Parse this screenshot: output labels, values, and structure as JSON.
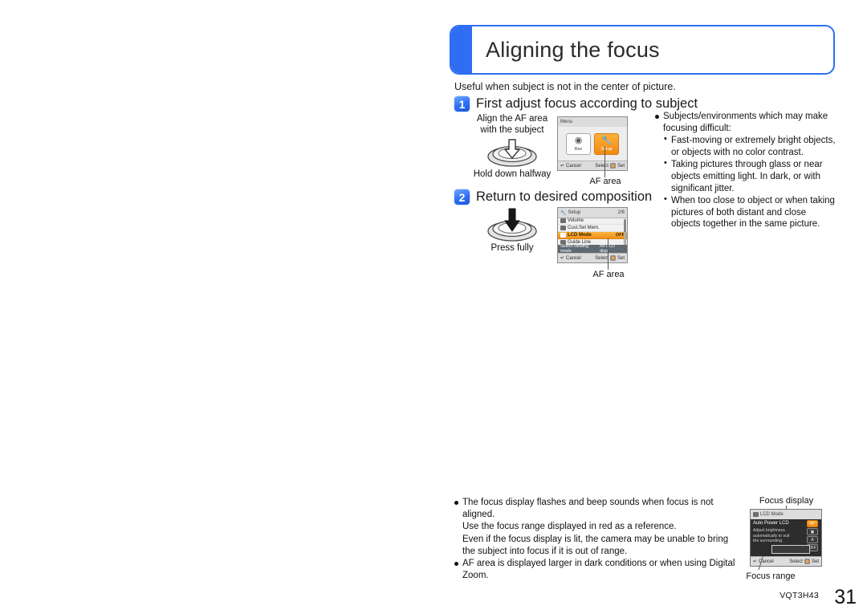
{
  "page": {
    "title": "Aligning the focus",
    "intro": "Useful when subject is not in the center of picture.",
    "footer_code": "VQT3H43",
    "footer_page": "31",
    "accent_color": "#2f6ef3",
    "highlight_color": "#f2901a"
  },
  "steps": [
    {
      "number": "1",
      "title": "First adjust focus according to subject",
      "illustration": {
        "caption_top_line1": "Align the AF area",
        "caption_top_line2": "with the subject",
        "caption_bottom": "Hold down halfway",
        "icon": "shutter-button-half-press-icon"
      },
      "callout": "AF area"
    },
    {
      "number": "2",
      "title": "Return to desired composition",
      "illustration": {
        "caption_top_line1": "",
        "caption_top_line2": "",
        "caption_bottom": "Press fully",
        "icon": "shutter-button-full-press-icon"
      },
      "callout": "AF area"
    }
  ],
  "screens": {
    "menu": {
      "topbar": "Menu",
      "tiles": [
        {
          "label": "Rec",
          "icon": "camera-icon",
          "selected": false
        },
        {
          "label": "Setup",
          "icon": "wrench-icon",
          "selected": true
        }
      ],
      "cancel": "Cancel",
      "select": "Select",
      "set": "Set"
    },
    "setup": {
      "topbar_title": "Setup",
      "topbar_page": "2/6",
      "rows": [
        {
          "label": "Volume",
          "value": "",
          "icon": "volume-icon",
          "selected": false
        },
        {
          "label": "Cust.Set Mem.",
          "value": "",
          "icon": "custom-set-icon",
          "selected": false
        },
        {
          "label": "LCD Mode",
          "value": "OFF",
          "icon": "lcd-mode-icon",
          "selected": true
        },
        {
          "label": "Guide Line",
          "value": "",
          "icon": "guide-line-icon",
          "selected": false
        }
      ],
      "hint_left": "Select viewing mode",
      "hint_right": "for LCD displ",
      "cancel": "Cancel",
      "select": "Select",
      "set": "Set"
    },
    "lcd_mode": {
      "topbar": "LCD Mode",
      "title": "Auto Power LCD",
      "description": "Adjust brightness automatically to suit the surrounding.",
      "options": [
        {
          "label": "A*",
          "selected": true
        },
        {
          "label": "▣",
          "selected": false
        },
        {
          "label": "A",
          "selected": false
        },
        {
          "label": "OFF",
          "selected": false
        }
      ],
      "cancel": "Cancel",
      "select": "Select",
      "set": "Set",
      "callout_top": "Focus display",
      "callout_bottom": "Focus range"
    }
  },
  "difficulty_notes": {
    "heading": "Subjects/environments which may make focusing difficult:",
    "items": [
      "Fast-moving or extremely bright objects, or objects with no color contrast.",
      "Taking pictures through glass or near objects emitting light. In dark, or with significant jitter.",
      "When too close to object or when taking pictures of both distant and close objects together in the same picture."
    ]
  },
  "bottom_notes": [
    {
      "lines": [
        "The focus display flashes and beep sounds when focus is not aligned.",
        "Use the focus range displayed in red as a reference.",
        "Even if the focus display is lit, the camera may be unable to bring the subject into focus if it is out of range."
      ]
    },
    {
      "lines": [
        "AF area is displayed larger in dark conditions or when using Digital Zoom."
      ]
    }
  ]
}
